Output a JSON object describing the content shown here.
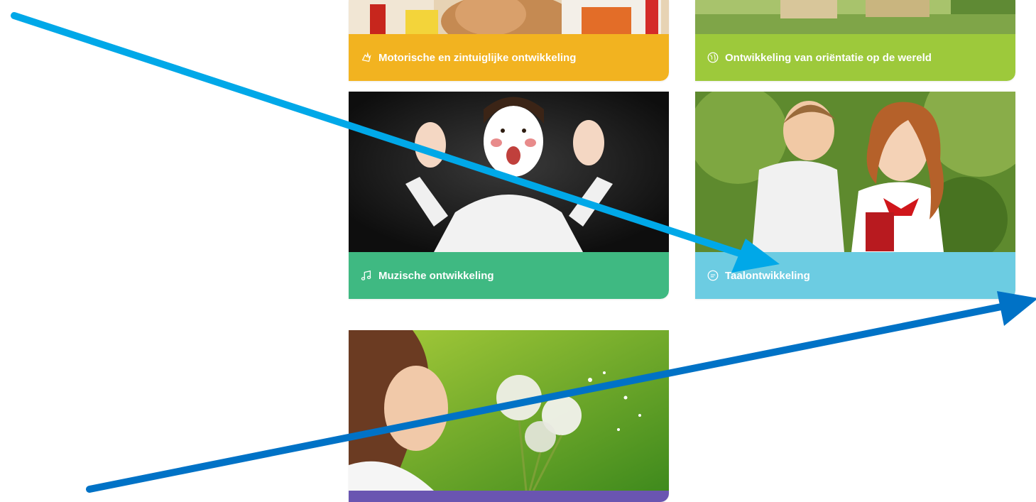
{
  "cards": [
    {
      "id": "motor",
      "label": "Motorische en zintuiglijke ontwikkeling",
      "color": "#f2b320",
      "icon": "hand-icon"
    },
    {
      "id": "orient",
      "label": "Ontwikkeling van oriëntatie op de wereld",
      "color": "#9dc93b",
      "icon": "globe-icon"
    },
    {
      "id": "muzisch",
      "label": "Muzische ontwikkeling",
      "color": "#3fb982",
      "icon": "music-note-icon"
    },
    {
      "id": "taal",
      "label": "Taalontwikkeling",
      "color": "#6ccce2",
      "icon": "speech-bubble-icon"
    },
    {
      "id": "extra",
      "label": "",
      "color": "#6a55b1",
      "icon": ""
    }
  ],
  "annotation_arrows": {
    "colors": [
      "#00a8e8",
      "#0072c6"
    ]
  }
}
